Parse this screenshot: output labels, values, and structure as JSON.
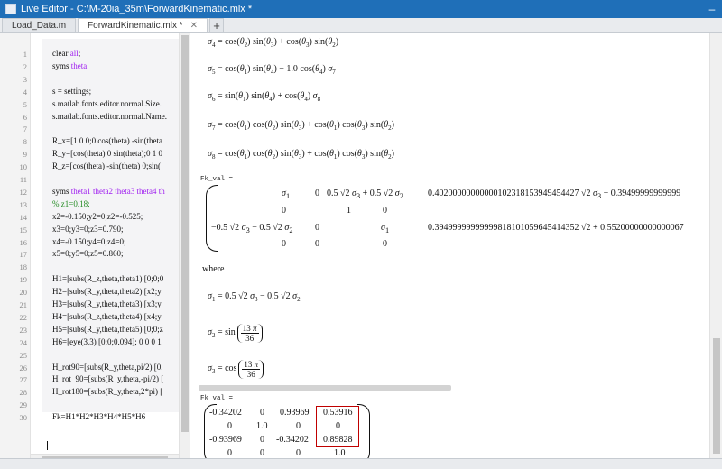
{
  "window": {
    "title": "Live Editor - C:\\M-20ia_35m\\ForwardKinematic.mlx *"
  },
  "tabs": [
    {
      "label": "Load_Data.m"
    },
    {
      "label": "ForwardKinematic.mlx *"
    }
  ],
  "editor": {
    "line_numbers": [
      "1",
      "2",
      "3",
      "4",
      "5",
      "6",
      "7",
      "8",
      "9",
      "10",
      "11",
      "12",
      "13",
      "14",
      "15",
      "16",
      "17",
      "18",
      "19",
      "20",
      "21",
      "22",
      "23",
      "24",
      "25",
      "26",
      "27",
      "28",
      "29",
      "30"
    ],
    "lines": [
      "clear all;",
      "syms theta",
      "",
      "s = settings;",
      "s.matlab.fonts.editor.normal.Size.",
      "s.matlab.fonts.editor.normal.Name.",
      "",
      "R_x=[1 0 0;0 cos(theta) -sin(theta",
      "R_y=[cos(theta) 0 sin(theta);0 1 0",
      "R_z=[cos(theta) -sin(theta) 0;sin(",
      "",
      "syms theta1 theta2 theta3 theta4 th",
      "% z1=0.18;",
      "x2=-0.150;y2=0;z2=-0.525;",
      "x3=0;y3=0;z3=0.790;",
      "x4=-0.150;y4=0;z4=0;",
      "x5=0;y5=0;z5=0.860;",
      "",
      "H1=[subs(R_z,theta,theta1) [0;0;0",
      "H2=[subs(R_y,theta,theta2) [x2;y",
      "H3=[subs(R_y,theta,theta3) [x3;y",
      "H4=[subs(R_z,theta,theta4) [x4;y",
      "H5=[subs(R_y,theta,theta5) [0;0;z",
      "H6=[eye(3,3) [0;0;0.094]; 0 0 0 1",
      "",
      "H_rot90=[subs(R_y,theta,pi/2) [0.",
      "H_rot_90=[subs(R_y,theta,-pi/2) [",
      "H_rot180=[subs(R_y,theta,2*pi) [",
      "",
      "Fk=H1*H2*H3*H4*H5*H6"
    ]
  },
  "output": {
    "sigma_defs": [
      {
        "lhs": "σ4",
        "rhs": "cos(θ2) sin(θ3) + cos(θ3) sin(θ2)"
      },
      {
        "lhs": "σ5",
        "rhs": "cos(θ1) sin(θ4) − 1.0 cos(θ4) σ7"
      },
      {
        "lhs": "σ6",
        "rhs": "sin(θ1) sin(θ4) + cos(θ4) σ8"
      },
      {
        "lhs": "σ7",
        "rhs": "cos(θ1) cos(θ2) sin(θ3) + cos(θ1) cos(θ3) sin(θ2)"
      },
      {
        "lhs": "σ8",
        "rhs": "cos(θ1) cos(θ2) sin(θ3) + cos(θ1) cos(θ3) sin(θ2)"
      }
    ],
    "fk_val_label_1": "Fk_val =",
    "big_matrix": {
      "rows": [
        [
          "σ1",
          "0",
          "0.5 √2 σ3 + 0.5 √2 σ2",
          "0.40200000000000102318153949454427 √2 σ3 − 0.39499999999999"
        ],
        [
          "0",
          "1",
          "0",
          ""
        ],
        [
          "−0.5 √2 σ3 − 0.5 √2 σ2",
          "0",
          "σ1",
          "0.39499999999999818101059645414352 √2 + 0.55200000000000067"
        ],
        [
          "0",
          "0",
          "0",
          ""
        ]
      ]
    },
    "where_label": "where",
    "where_defs": [
      {
        "lhs": "σ1",
        "rhs": "0.5 √2 σ3 − 0.5 √2 σ2"
      },
      {
        "lhs": "σ2",
        "func": "sin",
        "num": "13 π",
        "den": "36"
      },
      {
        "lhs": "σ3",
        "func": "cos",
        "num": "13 π",
        "den": "36"
      }
    ],
    "fk_val_label_2": "Fk_val =",
    "num_matrix": {
      "rows": [
        [
          "-0.34202",
          "0",
          "0.93969",
          "0.53916"
        ],
        [
          "0",
          "1.0",
          "0",
          "0"
        ],
        [
          "-0.93969",
          "0",
          "-0.34202",
          "0.89828"
        ],
        [
          "0",
          "0",
          "0",
          "1.0"
        ]
      ]
    }
  },
  "colors": {
    "title_bar": "#1f6fb8",
    "keyword": "#a020f0",
    "comment": "#228b22",
    "highlight_box": "#c00000"
  },
  "icons": {
    "app": "live-editor-icon",
    "minimize": "minimize-icon",
    "close_tab": "close-icon",
    "add_tab": "plus-icon"
  }
}
